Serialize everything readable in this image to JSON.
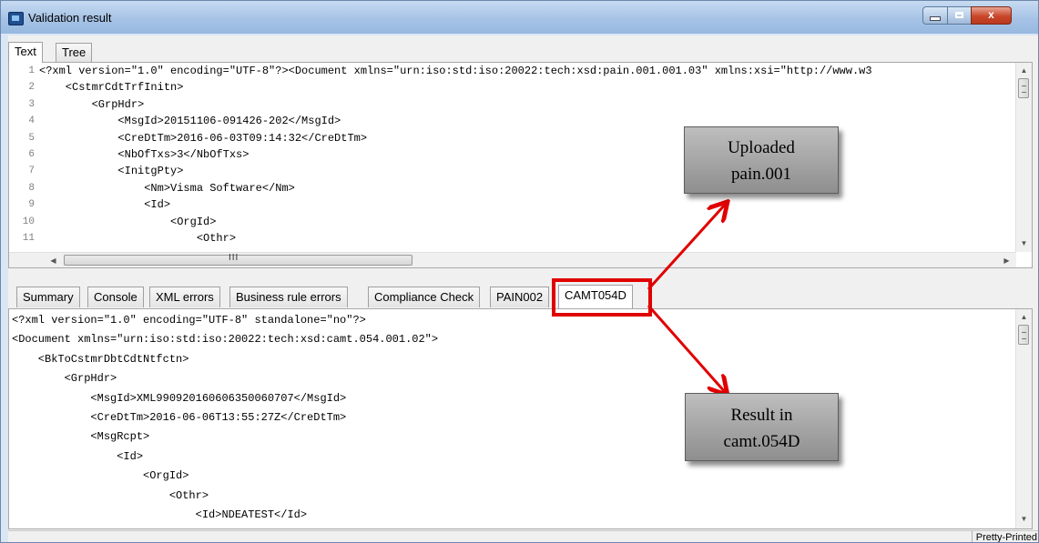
{
  "window": {
    "title": "Validation result",
    "buttons": {
      "minimize": "minimize",
      "maximize": "maximize",
      "close": "x"
    }
  },
  "top_tabs": [
    {
      "label": "Text",
      "active": true
    },
    {
      "label": "Tree",
      "active": false
    }
  ],
  "top_editor": {
    "line_numbers": [
      "1",
      "2",
      "3",
      "4",
      "5",
      "6",
      "7",
      "8",
      "9",
      "10",
      "11"
    ],
    "lines": [
      "<?xml version=\"1.0\" encoding=\"UTF-8\"?><Document xmlns=\"urn:iso:std:iso:20022:tech:xsd:pain.001.001.03\" xmlns:xsi=\"http://www.w3",
      "    <CstmrCdtTrfInitn>",
      "        <GrpHdr>",
      "            <MsgId>20151106-091426-202</MsgId>",
      "            <CreDtTm>2016-06-03T09:14:32</CreDtTm>",
      "            <NbOfTxs>3</NbOfTxs>",
      "            <InitgPty>",
      "                <Nm>Visma Software</Nm>",
      "                <Id>",
      "                    <OrgId>",
      "                        <Othr>"
    ],
    "hscroll_grip": "III"
  },
  "bottom_tabs": [
    {
      "label": "Summary",
      "active": false
    },
    {
      "label": "Console",
      "active": false
    },
    {
      "label": "XML errors",
      "active": false
    },
    {
      "label": "Business rule errors",
      "active": false
    },
    {
      "label": "Compliance Check",
      "active": false
    },
    {
      "label": "PAIN002",
      "active": false
    },
    {
      "label": "CAMT054D",
      "active": true
    }
  ],
  "bottom_editor": {
    "lines": [
      "<?xml version=\"1.0\" encoding=\"UTF-8\" standalone=\"no\"?>",
      "<Document xmlns=\"urn:iso:std:iso:20022:tech:xsd:camt.054.001.02\">",
      "    <BkToCstmrDbtCdtNtfctn>",
      "        <GrpHdr>",
      "            <MsgId>XML990920160606350060707</MsgId>",
      "            <CreDtTm>2016-06-06T13:55:27Z</CreDtTm>",
      "            <MsgRcpt>",
      "                <Id>",
      "                    <OrgId>",
      "                        <Othr>",
      "                            <Id>NDEATEST</Id>"
    ]
  },
  "status_bar": {
    "mode": "Pretty-Printed"
  },
  "annotations": {
    "callout_top": [
      "Uploaded",
      "pain.001"
    ],
    "callout_bottom": [
      "Result in",
      "camt.054D"
    ],
    "highlight_color": "#e00000"
  }
}
